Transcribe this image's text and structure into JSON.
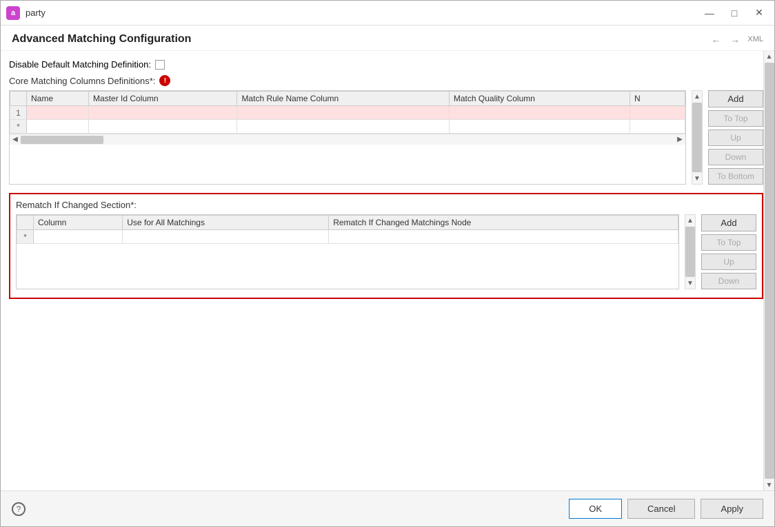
{
  "window": {
    "title": "party",
    "icon_label": "a"
  },
  "header": {
    "title": "Advanced Matching Configuration",
    "xml_label": "XML"
  },
  "disable_section": {
    "label": "Disable Default Matching Definition:"
  },
  "core_matching": {
    "label": "Core Matching Columns Definitions*:",
    "columns": [
      "Name",
      "Master Id Column",
      "Match Rule Name Column",
      "Match Quality Column",
      "N"
    ],
    "rows": [
      {
        "id": "1",
        "highlighted": true,
        "cells": [
          "",
          "",
          "",
          "",
          ""
        ]
      },
      {
        "id": "*",
        "highlighted": false,
        "cells": [
          "",
          "",
          "",
          "",
          ""
        ]
      }
    ],
    "buttons": {
      "add": "Add",
      "to_top": "To Top",
      "up": "Up",
      "down": "Down",
      "to_bottom": "To Bottom"
    }
  },
  "rematch_section": {
    "label": "Rematch If Changed Section*:",
    "columns": [
      "Column",
      "Use for All Matchings",
      "Rematch If Changed Matchings Node"
    ],
    "rows": [
      {
        "id": "*",
        "highlighted": false,
        "cells": [
          "",
          "",
          ""
        ]
      }
    ],
    "buttons": {
      "add": "Add",
      "to_top": "To Top",
      "up": "Up",
      "down": "Down"
    }
  },
  "footer": {
    "ok": "OK",
    "cancel": "Cancel",
    "apply": "Apply"
  }
}
